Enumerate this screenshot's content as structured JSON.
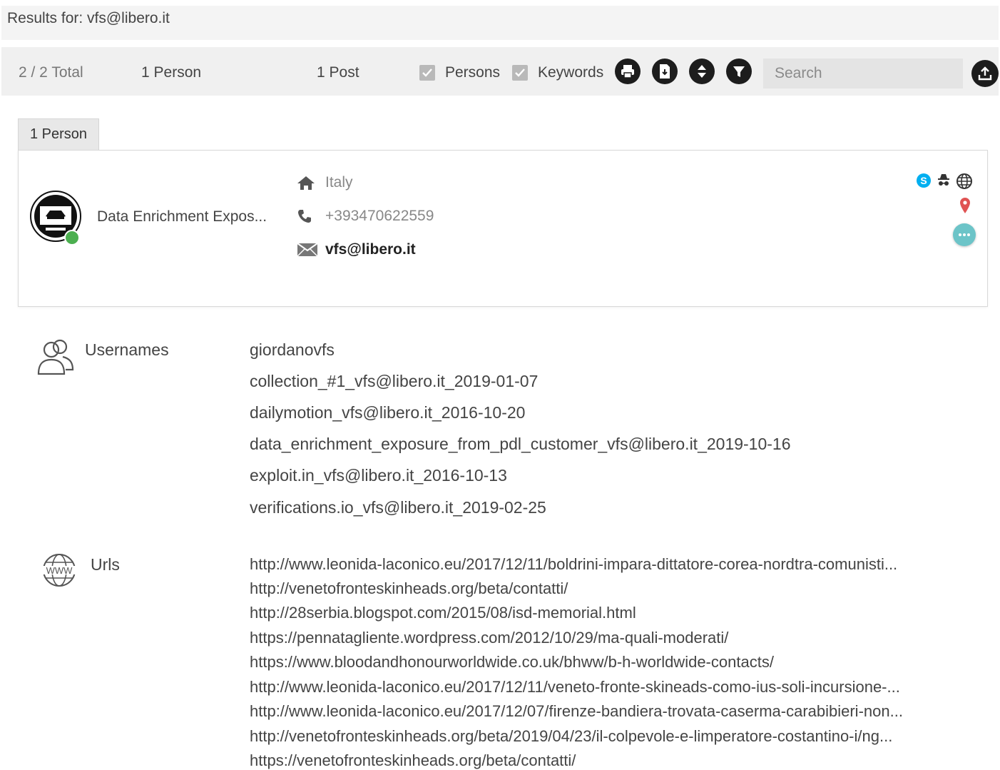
{
  "results": {
    "label": "Results for: vfs@libero.it"
  },
  "stats": {
    "total": "2 / 2 Total",
    "persons": "1 Person",
    "posts": "1 Post"
  },
  "filters": {
    "persons_label": "Persons",
    "keywords_label": "Keywords",
    "persons_checked": true,
    "keywords_checked": true
  },
  "toolbar": {
    "icons": [
      "print-icon",
      "pdf-export-icon",
      "sort-icon",
      "filter-icon"
    ],
    "export_icon": "upload-icon"
  },
  "search": {
    "placeholder": "Search",
    "value": ""
  },
  "tab": {
    "label": "1 Person"
  },
  "person": {
    "name": "Data Enrichment Expos...",
    "country": "Italy",
    "phone": "+393470622559",
    "email": "vfs@libero.it",
    "status_color": "#4caf50",
    "source_icons": [
      "skype-icon",
      "anonymous-icon",
      "globe-icon"
    ]
  },
  "usernames": {
    "label": "Usernames",
    "items": [
      "giordanovfs",
      "collection_#1_vfs@libero.it_2019-01-07",
      "dailymotion_vfs@libero.it_2016-10-20",
      "data_enrichment_exposure_from_pdl_customer_vfs@libero.it_2019-10-16",
      "exploit.in_vfs@libero.it_2016-10-13",
      "verifications.io_vfs@libero.it_2019-02-25"
    ]
  },
  "urls": {
    "label": "Urls",
    "items": [
      "http://www.leonida-laconico.eu/2017/12/11/boldrini-impara-dittatore-corea-nordtra-comunisti...",
      "http://venetofronteskinheads.org/beta/contatti/",
      "http://28serbia.blogspot.com/2015/08/isd-memorial.html",
      "https://pennatagliente.wordpress.com/2012/10/29/ma-quali-moderati/",
      "https://www.bloodandhonourworldwide.co.uk/bhww/b-h-worldwide-contacts/",
      "http://www.leonida-laconico.eu/2017/12/11/veneto-fronte-skineads-como-ius-soli-incursione-...",
      "http://www.leonida-laconico.eu/2017/12/07/firenze-bandiera-trovata-caserma-carabibieri-non...",
      "http://venetofronteskinheads.org/beta/2019/04/23/il-colpevole-e-limperatore-costantino-i/ng...",
      "https://venetofronteskinheads.org/beta/contatti/"
    ]
  }
}
